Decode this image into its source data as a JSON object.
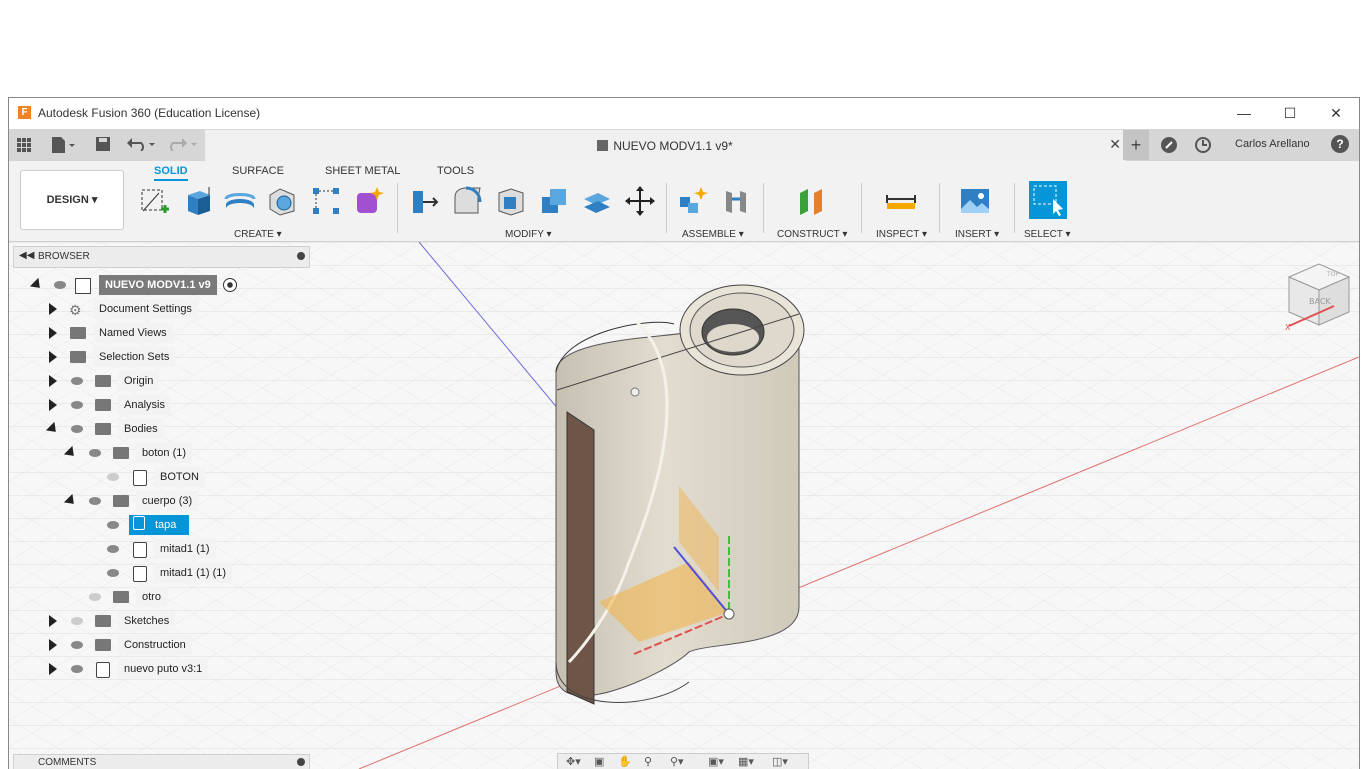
{
  "window": {
    "title": "Autodesk Fusion 360 (Education License)",
    "logo": "F",
    "controls": [
      "minimize-icon",
      "maximize-icon",
      "close-icon"
    ]
  },
  "tabbar": {
    "doc_name": "NUEVO MODV1.1 v9*",
    "user": "Carlos Arellano",
    "help": "?"
  },
  "toolbar": {
    "workspace": "DESIGN",
    "tabs": [
      "SOLID",
      "SURFACE",
      "SHEET METAL",
      "TOOLS"
    ],
    "active_tab": "SOLID",
    "groups": [
      "CREATE",
      "MODIFY",
      "ASSEMBLE",
      "CONSTRUCT",
      "INSPECT",
      "INSERT",
      "SELECT"
    ]
  },
  "browser": {
    "title": "BROWSER",
    "root": "NUEVO MODV1.1 v9",
    "items": [
      {
        "label": "Document Settings"
      },
      {
        "label": "Named Views"
      },
      {
        "label": "Selection Sets"
      },
      {
        "label": "Origin"
      },
      {
        "label": "Analysis"
      },
      {
        "label": "Bodies"
      },
      {
        "label": "boton (1)"
      },
      {
        "label": "BOTON"
      },
      {
        "label": "cuerpo (3)"
      },
      {
        "label": "tapa"
      },
      {
        "label": "mitad1 (1)"
      },
      {
        "label": "mitad1 (1) (1)"
      },
      {
        "label": "otro"
      },
      {
        "label": "Sketches"
      },
      {
        "label": "Construction"
      },
      {
        "label": "nuevo puto v3:1"
      }
    ]
  },
  "comments": {
    "title": "COMMENTS"
  },
  "viewcube": {
    "face": "BACK",
    "top": "TOP",
    "axis_x": "X"
  },
  "colors": {
    "accent": "#0696d7",
    "selected": "#0696d7",
    "body": "#d8d2c4",
    "axis_red": "#e05050",
    "axis_green": "#40c040",
    "axis_blue": "#5050e0"
  }
}
